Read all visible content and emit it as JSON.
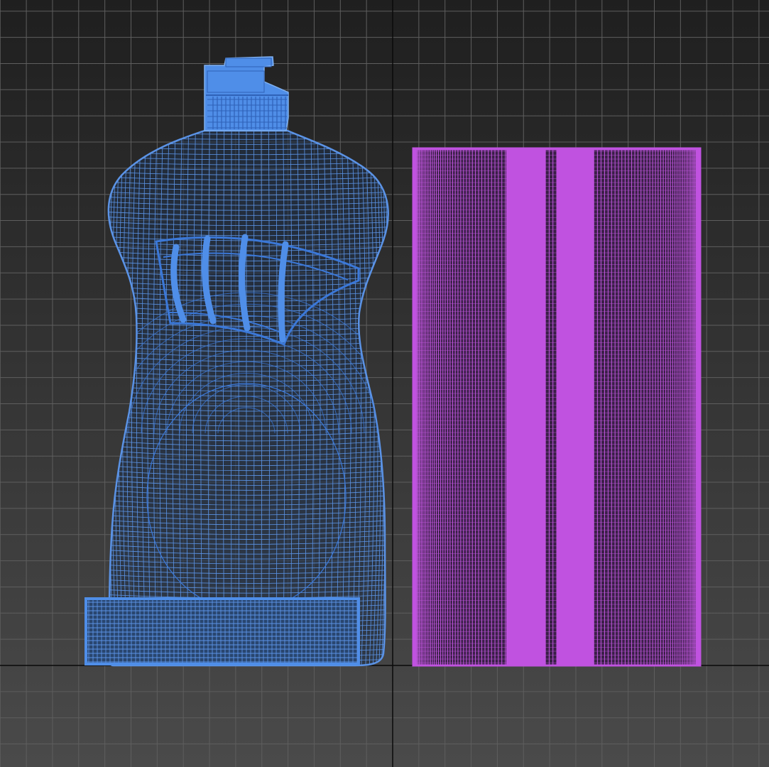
{
  "viewport": {
    "view": "front",
    "shading": "wireframe",
    "grid": true
  },
  "colors": {
    "background_top": "#1f1f1f",
    "background_bottom": "#4a4a4a",
    "grid_line": "#5e5e5e",
    "axis_line": "#0a0a0a",
    "bottle_wire": "#5b93e6",
    "bottle_fill": "#4f8ee8",
    "bottle_wire_dense": "#3b78d8",
    "sleeve_wire": "#c257e0",
    "sleeve_fill": "#c052e0"
  },
  "objects": [
    {
      "name": "bottle",
      "kind": "dish-soap bottle mesh"
    },
    {
      "name": "label-sleeve",
      "kind": "cylindrical label mesh"
    }
  ]
}
